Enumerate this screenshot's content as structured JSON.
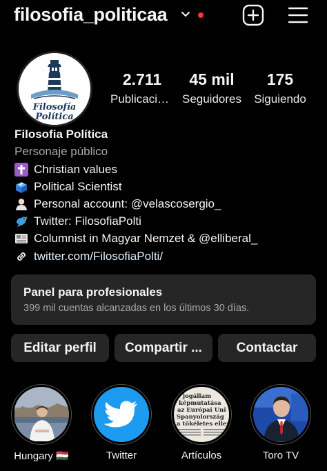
{
  "header": {
    "username": "filosofia_politicaa",
    "icons": [
      "chevron-down-icon",
      "notification-dot",
      "create-post-icon",
      "menu-icon"
    ],
    "dot_color": "#ff3040"
  },
  "profile": {
    "avatar_text_1": "Filosofía",
    "avatar_text_2": "Política",
    "stats": [
      {
        "value": "2.711",
        "label": "Publicaciones"
      },
      {
        "value": "45 mil",
        "label": "Seguidores"
      },
      {
        "value": "175",
        "label": "Siguiendo"
      }
    ],
    "name": "Filosofia Política",
    "category": "Personaje público",
    "bio": [
      {
        "icon": "latin-cross-icon",
        "text": "Christian values"
      },
      {
        "icon": "ballot-box-icon",
        "text": "Political Scientist"
      },
      {
        "icon": "person-icon",
        "text": "Personal account: @velascosergio_"
      },
      {
        "icon": "bird-icon",
        "text": "Twitter: FilosofiaPolti"
      },
      {
        "icon": "newspaper-icon",
        "text": "Columnist in Magyar Nemzet & @elliberal_"
      },
      {
        "icon": "link-icon",
        "text": "twitter.com/FilosofiaPolti/"
      }
    ]
  },
  "panel": {
    "title": "Panel para profesionales",
    "subtitle": "399 mil cuentas alcanzadas en los últimos 30 días."
  },
  "actions": {
    "edit": "Editar perfil",
    "share": "Compartir ...",
    "contact": "Contactar"
  },
  "highlights": [
    {
      "label": "Hungary 🇭🇺"
    },
    {
      "label": "Twitter"
    },
    {
      "label": "Artículos"
    },
    {
      "label": "Toro TV"
    }
  ],
  "highlight_article_text": [
    "jogállam",
    "képmutatása",
    "az Európai Uni",
    "Spanyolország",
    "a tökéletes ellen"
  ]
}
